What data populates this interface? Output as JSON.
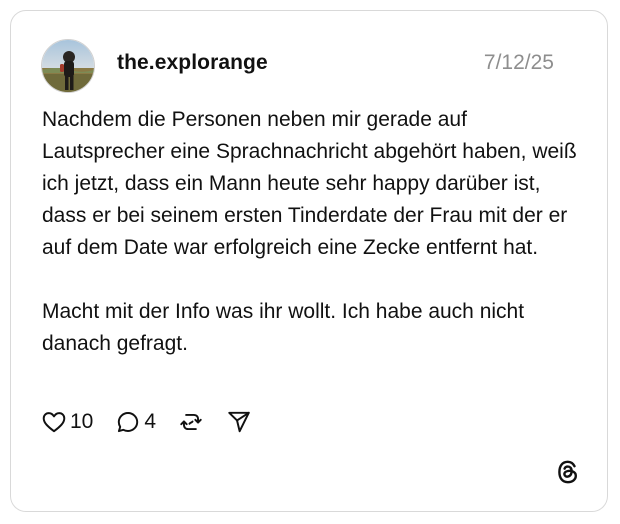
{
  "post": {
    "username": "the.explorange",
    "date": "7/12/25",
    "body_paragraph_1": "Nachdem die Personen neben mir gerade auf Lautsprecher eine Sprachnachricht abgehört haben, weiß ich jetzt, dass ein Mann heute sehr happy darüber ist, dass er bei seinem ersten Tinderdate der Frau mit der er auf dem Date war erfolgreich eine Zecke entfernt hat.",
    "body_paragraph_2": "Macht mit der Info was ihr wollt. Ich habe auch nicht danach gefragt."
  },
  "actions": {
    "like_icon": "heart-icon",
    "like_count": "10",
    "reply_icon": "speech-bubble-icon",
    "reply_count": "4",
    "repost_icon": "repost-icon",
    "share_icon": "paper-plane-icon"
  },
  "brand": {
    "logo_icon": "threads-logo-icon"
  },
  "colors": {
    "text": "#111111",
    "muted": "#8e8e8e",
    "border": "#d9d9d9"
  }
}
